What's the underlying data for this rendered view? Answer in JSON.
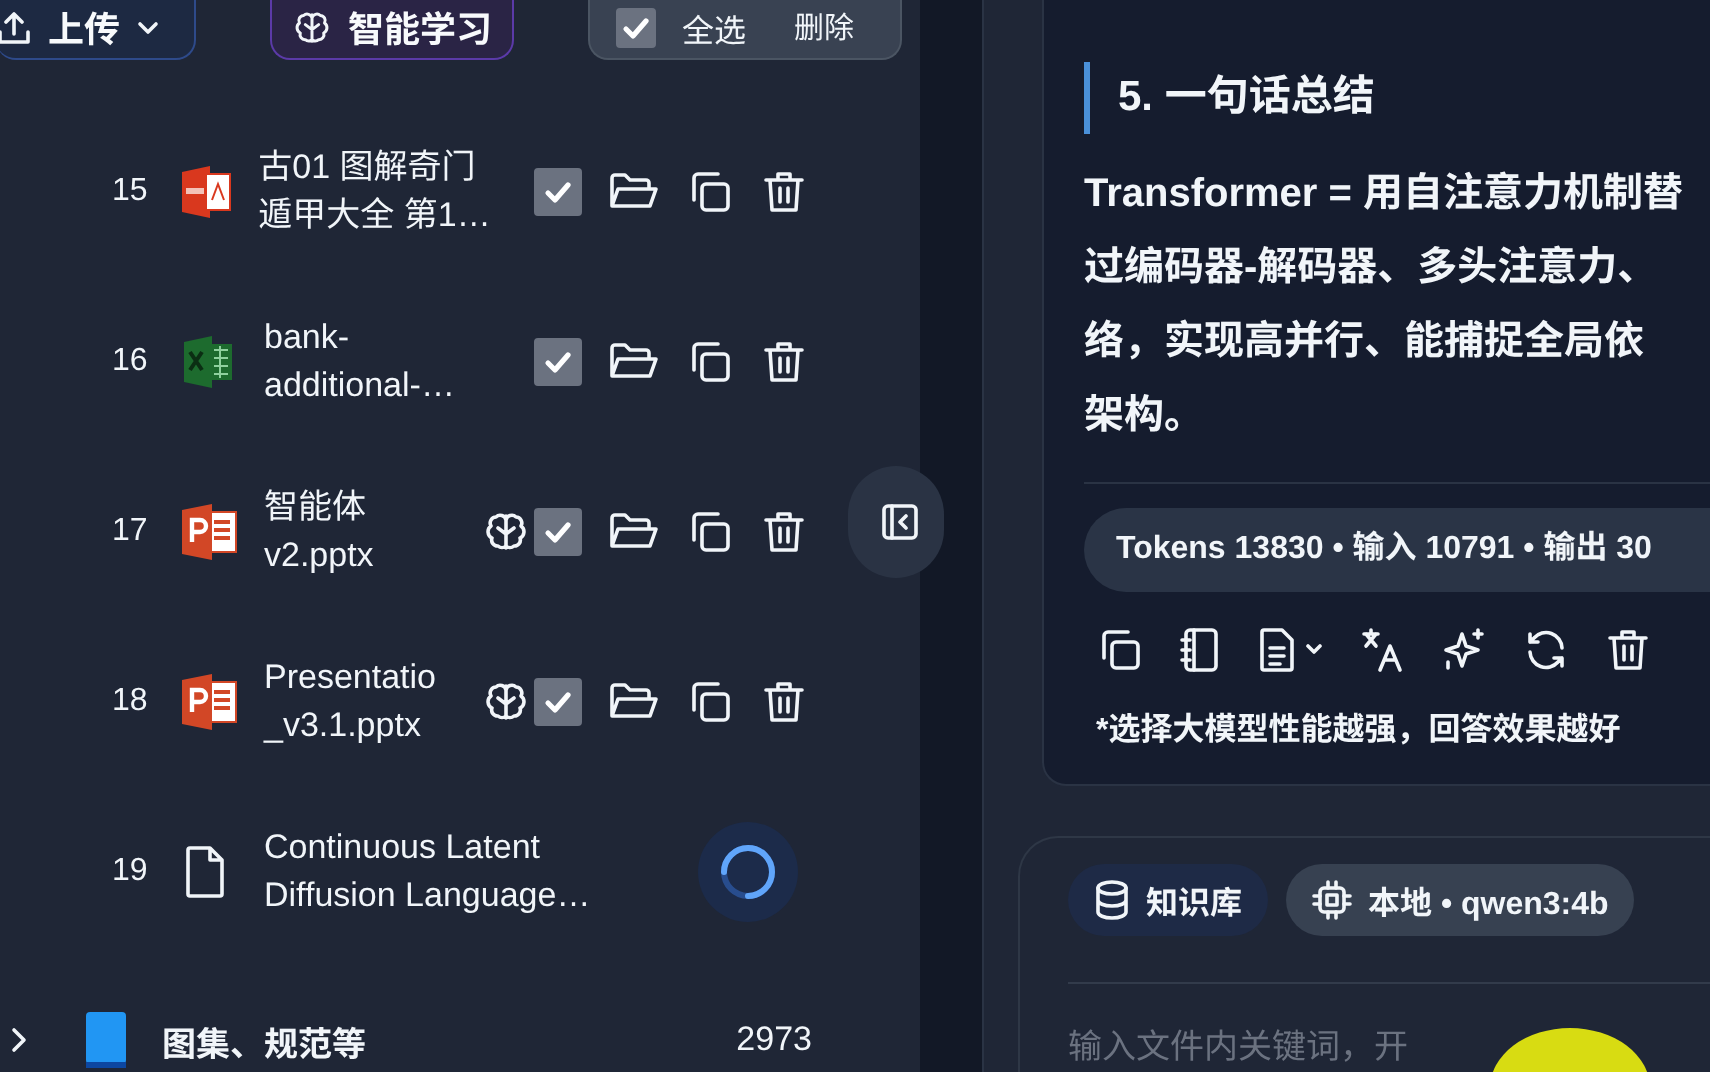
{
  "toolbar": {
    "upload_button": "上传",
    "learn_button": "智能学习",
    "select_all": {
      "label": "全选",
      "checked": true
    },
    "delete_button": "删除"
  },
  "files": [
    {
      "number": "15",
      "kind": "pdf",
      "name_lines": [
        "古01 图解奇门",
        "遁甲大全 第1…"
      ],
      "learned": false,
      "checked": true,
      "processing": false
    },
    {
      "number": "16",
      "kind": "spreadsheet",
      "name_lines": [
        "bank-",
        "additional-…"
      ],
      "learned": false,
      "checked": true,
      "processing": false
    },
    {
      "number": "17",
      "kind": "presentation",
      "name_lines": [
        "智能体",
        "v2.pptx"
      ],
      "learned": true,
      "checked": true,
      "processing": false
    },
    {
      "number": "18",
      "kind": "presentation",
      "name_lines": [
        "Presentatio",
        "_v3.1.pptx"
      ],
      "learned": true,
      "checked": true,
      "processing": false
    },
    {
      "number": "19",
      "kind": "document",
      "name_lines": [
        "Continuous Latent",
        "Diffusion Language…"
      ],
      "processing": true
    }
  ],
  "folder": {
    "name": "图集、规范等",
    "count": "2973",
    "expanded": false
  },
  "answer": {
    "heading": "5. 一句话总结",
    "lines": [
      "Transformer = 用自注意力机制替",
      "过编码器-解码器、多头注意力、",
      "络，实现高并行、能捕捉全局依",
      "架构。"
    ],
    "tokens": "Tokens 13830 • 输入 10791 • 输出 30",
    "note": "*选择大模型性能越强，回答效果越好"
  },
  "composer": {
    "chips": [
      {
        "kind": "knowledge",
        "label": "知识库",
        "selected": true
      },
      {
        "kind": "model",
        "label": "本地 • qwen3:4b",
        "selected": false
      }
    ],
    "placeholder": "输入文件内关键词，开"
  }
}
